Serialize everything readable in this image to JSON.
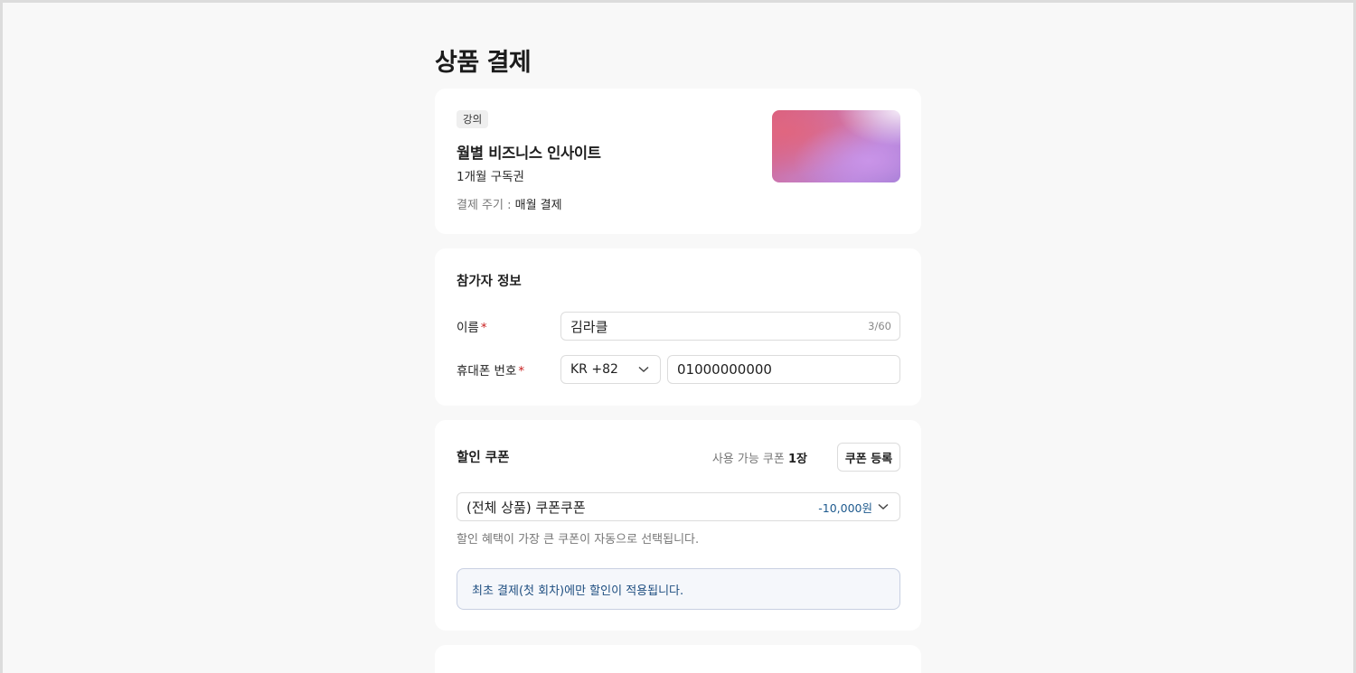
{
  "page": {
    "title": "상품 결제"
  },
  "product": {
    "tag": "강의",
    "name": "월별 비즈니스 인사이트",
    "subtitle": "1개월 구독권",
    "cycle_label": "결제 주기 : ",
    "cycle_value": "매월 결제"
  },
  "participant": {
    "section_title": "참가자 정보",
    "name_label": "이름",
    "name_value": "김라클",
    "name_counter": "3/60",
    "phone_label": "휴대폰 번호",
    "country_code": "KR +82",
    "phone_value": "01000000000",
    "required_mark": "*"
  },
  "coupon": {
    "section_title": "할인 쿠폰",
    "available_label": "사용 가능 쿠폰",
    "available_count": "1장",
    "register_button": "쿠폰 등록",
    "selected_coupon": "(전체 상품) 쿠폰쿠폰",
    "discount": "-10,000원",
    "hint": "할인 혜택이 가장 큰 쿠폰이 자동으로 선택됩니다.",
    "notice": "최초 결제(첫 회차)에만 할인이 적용됩니다."
  },
  "icons": {
    "country_chevron": "chevron-down-icon",
    "coupon_chevron": "chevron-down-icon"
  },
  "colors": {
    "background": "#f8f8f8",
    "card": "#ffffff",
    "required": "#c81e1e",
    "discount": "#1e5a8e",
    "notice_bg": "#f5f7fb",
    "notice_border": "#c8d0e2"
  }
}
